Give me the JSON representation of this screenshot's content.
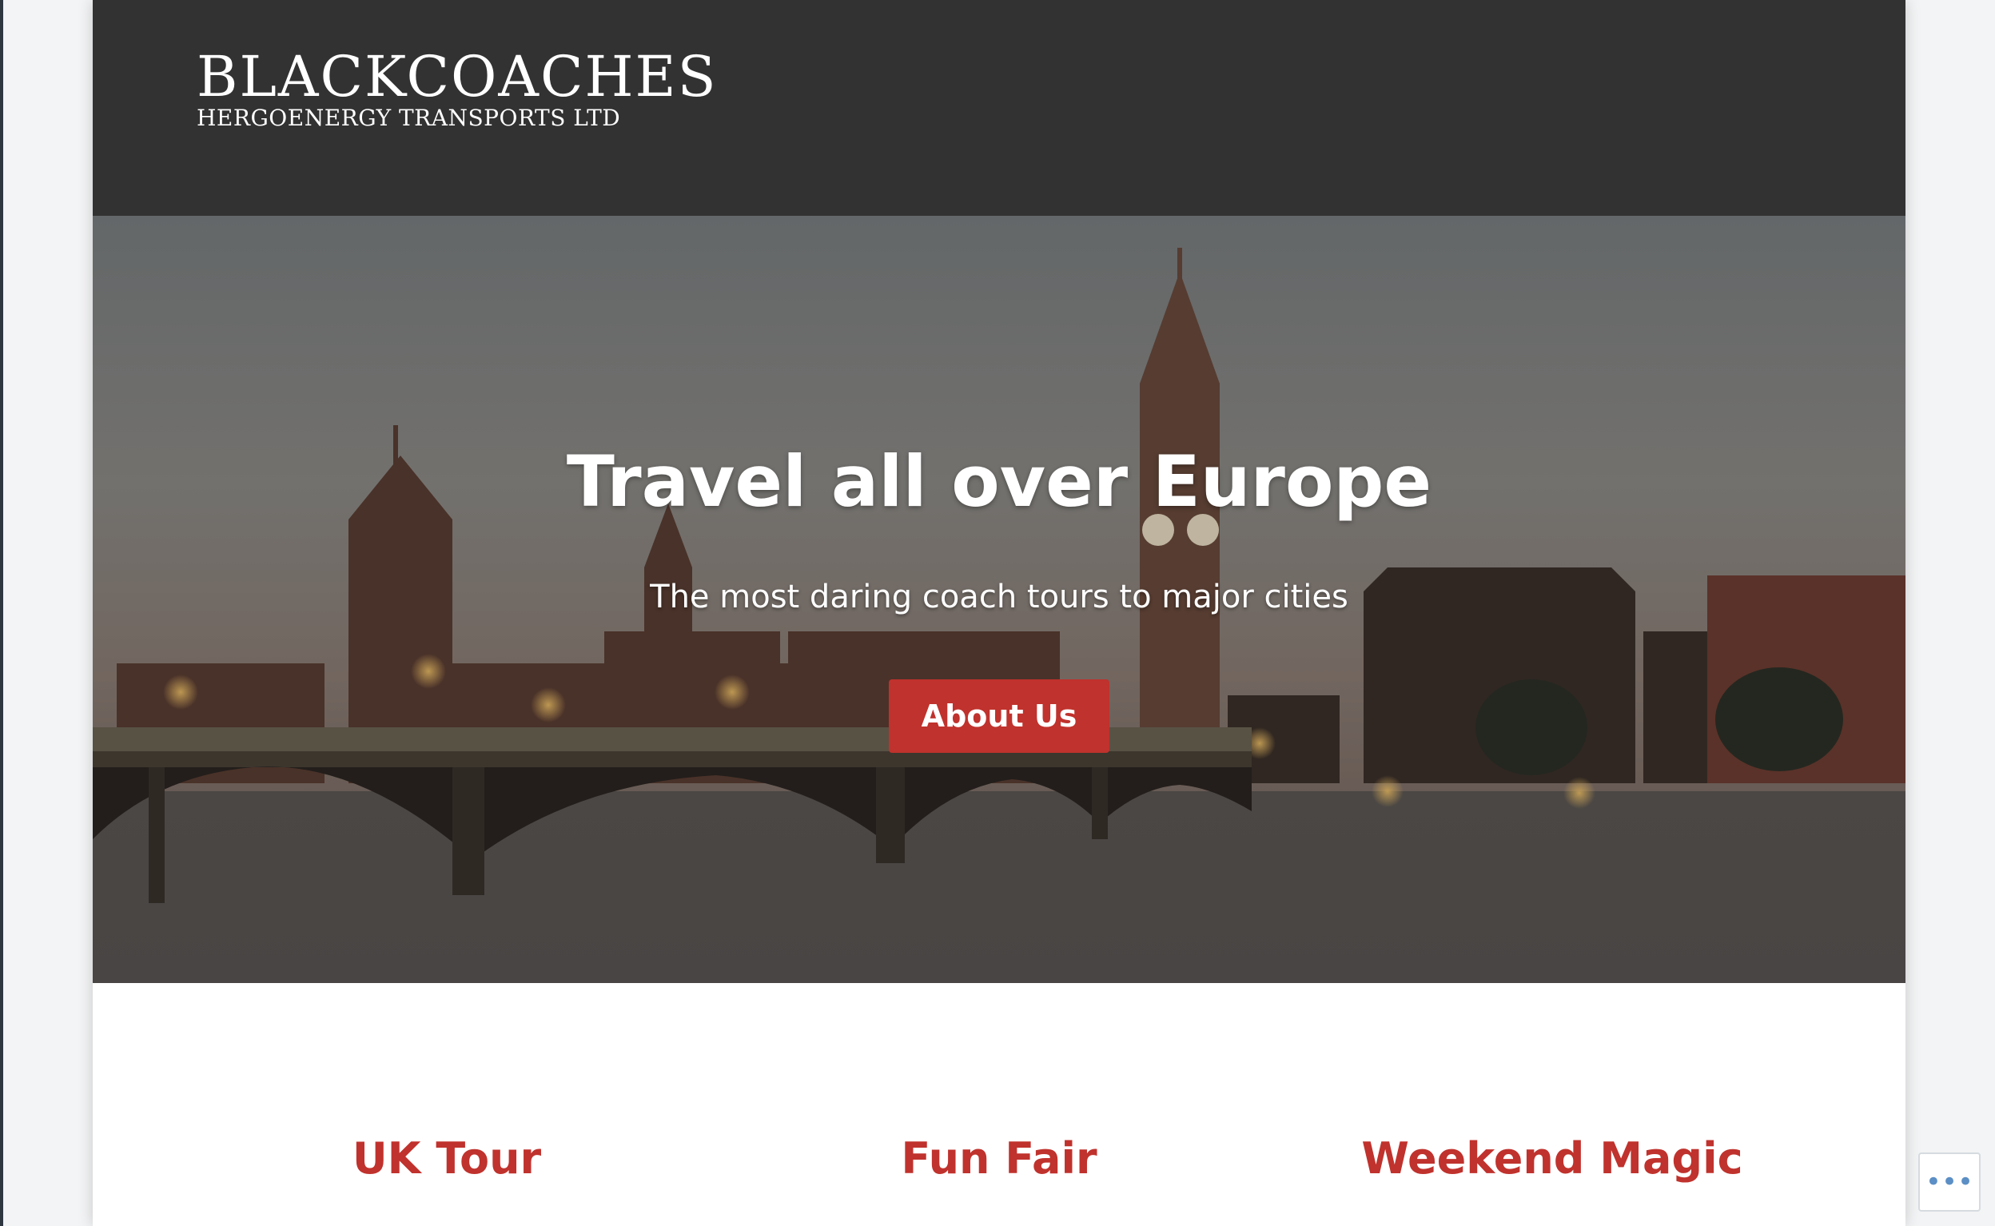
{
  "site": {
    "logo_title": "BLACKCOACHES",
    "logo_subtitle": "HERGOENERGY TRANSPORTS LTD"
  },
  "hero": {
    "title": "Travel all over Europe",
    "subtitle": "The most daring coach tours to major cities",
    "button_label": "About Us"
  },
  "features": [
    {
      "title": "UK Tour"
    },
    {
      "title": "Fun Fair"
    },
    {
      "title": "Weekend Magic"
    }
  ],
  "floating": {
    "more_icon": "ellipsis-icon",
    "more_glyph": "•••"
  },
  "colors": {
    "header_bg": "#323232",
    "accent": "#c0322d",
    "page_bg": "#f3f4f5"
  }
}
